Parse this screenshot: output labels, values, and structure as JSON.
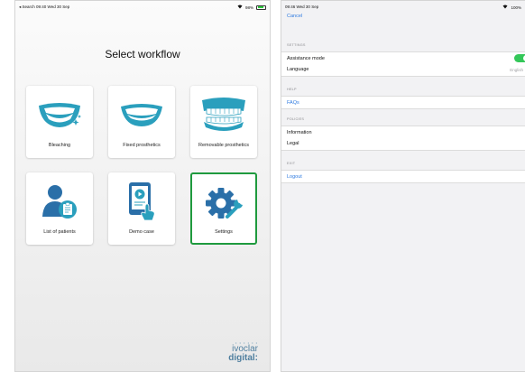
{
  "left_screen": {
    "status": {
      "left": "◂ Search  09:40  Wed 30 Sep",
      "right": "98%"
    },
    "title": "Select workflow",
    "tiles": [
      {
        "label": "Bleaching",
        "icon": "bleaching-smile-icon"
      },
      {
        "label": "Fixed prosthetics",
        "icon": "fixed-prosthetics-icon"
      },
      {
        "label": "Removable prosthetics",
        "icon": "removable-prosthetics-icon"
      },
      {
        "label": "List of patients",
        "icon": "patient-list-icon"
      },
      {
        "label": "Demo case",
        "icon": "demo-case-tablet-icon"
      },
      {
        "label": "Settings",
        "icon": "settings-gear-icon",
        "selected": true
      }
    ],
    "brand": {
      "line1": "ivoclar",
      "line2": "digital:"
    }
  },
  "right_screen": {
    "status": {
      "left": "09:46  Wed 30 Sep",
      "right": "100%"
    },
    "cancel_label": "Cancel",
    "sections": {
      "settings": {
        "header": "SETTINGS",
        "assistance_mode": "Assistance mode",
        "assistance_mode_on": true,
        "language": "Language",
        "language_value": "English"
      },
      "help": {
        "header": "HELP",
        "faqs": "FAQs"
      },
      "policies": {
        "header": "POLICIES",
        "information": "Information",
        "legal": "Legal"
      },
      "exit": {
        "header": "EXIT",
        "logout": "Logout"
      }
    }
  },
  "colors": {
    "accent_blue": "#2f7be0",
    "selected_green": "#1f9a3e",
    "toggle_green": "#34c759",
    "brand_blue": "#4f7f9f"
  }
}
